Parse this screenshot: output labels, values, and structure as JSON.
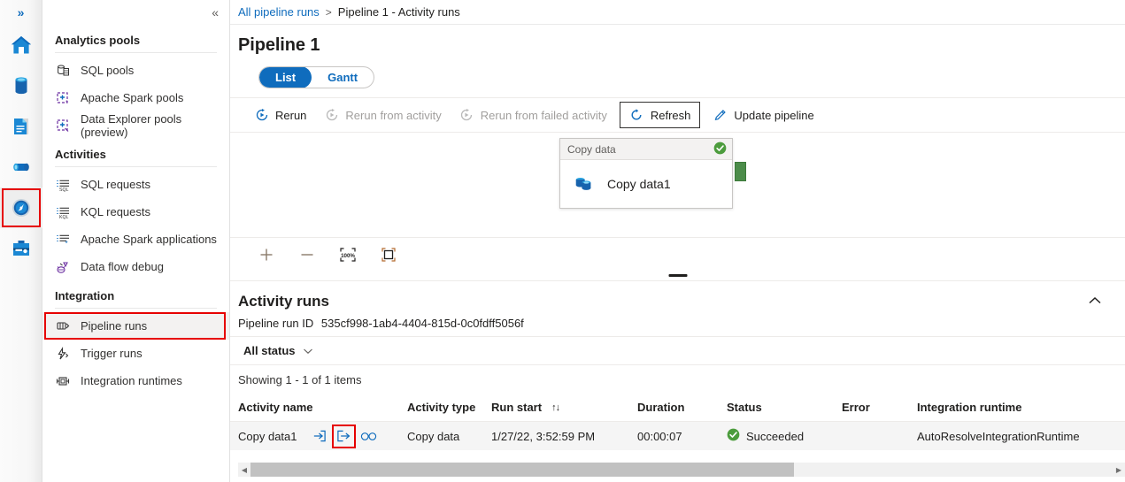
{
  "rail": {
    "expand_label": "»",
    "items": [
      {
        "name": "home",
        "label": "Home",
        "selected": false
      },
      {
        "name": "data",
        "label": "Data",
        "selected": false
      },
      {
        "name": "develop",
        "label": "Develop",
        "selected": false
      },
      {
        "name": "integrate",
        "label": "Integrate",
        "selected": false
      },
      {
        "name": "monitor",
        "label": "Monitor",
        "selected": true
      },
      {
        "name": "manage",
        "label": "Manage",
        "selected": false
      }
    ]
  },
  "nav": {
    "collapse_label": "«",
    "groups": [
      {
        "title": "Analytics pools",
        "items": [
          {
            "label": "SQL pools",
            "icon": "sql-pools-icon",
            "active": false
          },
          {
            "label": "Apache Spark pools",
            "icon": "spark-pools-icon",
            "active": false
          },
          {
            "label": "Data Explorer pools (preview)",
            "icon": "data-explorer-pools-icon",
            "active": false
          }
        ]
      },
      {
        "title": "Activities",
        "items": [
          {
            "label": "SQL requests",
            "icon": "sql-requests-icon",
            "active": false
          },
          {
            "label": "KQL requests",
            "icon": "kql-requests-icon",
            "active": false
          },
          {
            "label": "Apache Spark applications",
            "icon": "spark-applications-icon",
            "active": false
          },
          {
            "label": "Data flow debug",
            "icon": "data-flow-debug-icon",
            "active": false
          }
        ]
      },
      {
        "title": "Integration",
        "items": [
          {
            "label": "Pipeline runs",
            "icon": "pipeline-runs-icon",
            "active": true
          },
          {
            "label": "Trigger runs",
            "icon": "trigger-runs-icon",
            "active": false
          },
          {
            "label": "Integration runtimes",
            "icon": "integration-runtimes-icon",
            "active": false
          }
        ]
      }
    ]
  },
  "breadcrumb": {
    "root": "All pipeline runs",
    "separator": ">",
    "current": "Pipeline 1 - Activity runs"
  },
  "page": {
    "title": "Pipeline 1"
  },
  "pivot": {
    "list": "List",
    "gantt": "Gantt",
    "selected": "List"
  },
  "toolbar": {
    "rerun": "Rerun",
    "rerun_from_activity": "Rerun from activity",
    "rerun_from_failed_activity": "Rerun from failed activity",
    "refresh": "Refresh",
    "update_pipeline": "Update pipeline"
  },
  "canvas": {
    "node": {
      "type_label": "Copy data",
      "name": "Copy data1",
      "status": "succeeded"
    },
    "controls": {
      "zoom_in": "+",
      "zoom_out": "−",
      "zoom_reset": "100%",
      "fit_to_screen": "Fit to screen"
    }
  },
  "activity_runs": {
    "title": "Activity runs",
    "run_id_label": "Pipeline run ID",
    "run_id_value": "535cf998-1ab4-4404-815d-0c0fdff5056f",
    "filter_label": "All status",
    "showing": "Showing 1 - 1 of 1 items",
    "columns": [
      "Activity name",
      "Activity type",
      "Run start",
      "Duration",
      "Status",
      "Error",
      "Integration runtime"
    ],
    "sort_glyph": "↑↓",
    "rows": [
      {
        "activity_name": "Copy data1",
        "actions": [
          "input-icon",
          "output-icon",
          "details-icon"
        ],
        "activity_type": "Copy data",
        "run_start": "1/27/22, 3:52:59 PM",
        "duration": "00:00:07",
        "status": "Succeeded",
        "error": "",
        "integration_runtime": "AutoResolveIntegrationRuntime"
      }
    ]
  },
  "colors": {
    "accent": "#0f6cbd",
    "success": "#4c9c3d",
    "highlight": "#e60000",
    "text": "#201f1e",
    "muted": "#605e5c"
  }
}
